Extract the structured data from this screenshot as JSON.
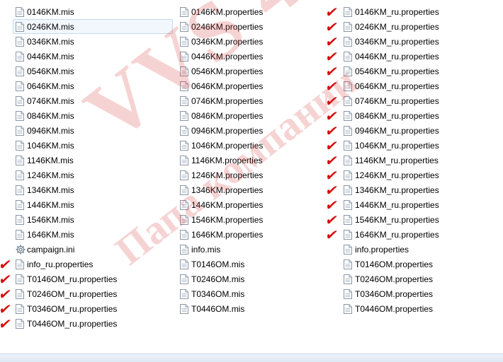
{
  "watermark": {
    "line1": "VVS 46",
    "line2": "Папа компании"
  },
  "columns": [
    [
      {
        "name": "0146KM.mis"
      },
      {
        "name": "0246KM.mis",
        "selected": true
      },
      {
        "name": "0346KM.mis"
      },
      {
        "name": "0446KM.mis"
      },
      {
        "name": "0546KM.mis"
      },
      {
        "name": "0646KM.mis"
      },
      {
        "name": "0746KM.mis"
      },
      {
        "name": "0846KM.mis"
      },
      {
        "name": "0946KM.mis"
      },
      {
        "name": "1046KM.mis"
      },
      {
        "name": "1146KM.mis"
      },
      {
        "name": "1246KM.mis"
      },
      {
        "name": "1346KM.mis"
      },
      {
        "name": "1446KM.mis"
      },
      {
        "name": "1546KM.mis"
      },
      {
        "name": "1646KM.mis"
      },
      {
        "name": "campaign.ini",
        "icon": "settings-file-icon"
      },
      {
        "name": "info_ru.properties",
        "checked": true
      },
      {
        "name": "T0146OM_ru.properties",
        "checked": true
      },
      {
        "name": "T0246OM_ru.properties",
        "checked": true
      },
      {
        "name": "T0346OM_ru.properties",
        "checked": true
      },
      {
        "name": "T0446OM_ru.properties",
        "checked": true
      }
    ],
    [
      {
        "name": "0146KM.properties"
      },
      {
        "name": "0246KM.properties"
      },
      {
        "name": "0346KM.properties"
      },
      {
        "name": "0446KM.properties"
      },
      {
        "name": "0546KM.properties"
      },
      {
        "name": "0646KM.properties"
      },
      {
        "name": "0746KM.properties"
      },
      {
        "name": "0846KM.properties"
      },
      {
        "name": "0946KM.properties"
      },
      {
        "name": "1046KM.properties"
      },
      {
        "name": "1146KM.properties"
      },
      {
        "name": "1246KM.properties"
      },
      {
        "name": "1346KM.properties"
      },
      {
        "name": "1446KM.properties"
      },
      {
        "name": "1546KM.properties"
      },
      {
        "name": "1646KM.properties"
      },
      {
        "name": "info.mis"
      },
      {
        "name": "T0146OM.mis"
      },
      {
        "name": "T0246OM.mis"
      },
      {
        "name": "T0346OM.mis"
      },
      {
        "name": "T0446OM.mis"
      }
    ],
    [
      {
        "name": "0146KM_ru.properties",
        "checked": true
      },
      {
        "name": "0246KM_ru.properties",
        "checked": true
      },
      {
        "name": "0346KM_ru.properties",
        "checked": true
      },
      {
        "name": "0446KM_ru.properties",
        "checked": true
      },
      {
        "name": "0546KM_ru.properties",
        "checked": true
      },
      {
        "name": "0646KM_ru.properties",
        "checked": true
      },
      {
        "name": "0746KM_ru.properties",
        "checked": true
      },
      {
        "name": "0846KM_ru.properties",
        "checked": true
      },
      {
        "name": "0946KM_ru.properties",
        "checked": true
      },
      {
        "name": "1046KM_ru.properties",
        "checked": true
      },
      {
        "name": "1146KM_ru.properties",
        "checked": true
      },
      {
        "name": "1246KM_ru.properties",
        "checked": true
      },
      {
        "name": "1346KM_ru.properties",
        "checked": true
      },
      {
        "name": "1446KM_ru.properties",
        "checked": true
      },
      {
        "name": "1546KM_ru.properties",
        "checked": true
      },
      {
        "name": "1646KM_ru.properties",
        "checked": true
      },
      {
        "name": "info.properties"
      },
      {
        "name": "T0146OM.properties"
      },
      {
        "name": "T0246OM.properties"
      },
      {
        "name": "T0346OM.properties"
      },
      {
        "name": "T0446OM.properties"
      }
    ]
  ]
}
